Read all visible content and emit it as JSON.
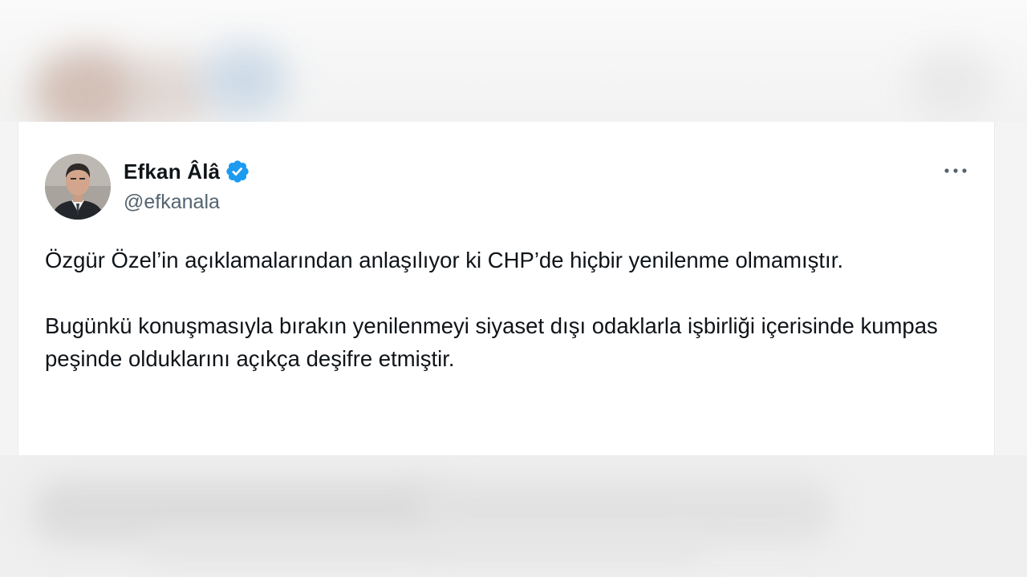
{
  "tweet": {
    "author_name": "Efkan Âlâ",
    "author_handle": "@efkanala",
    "verified_icon": "verified-badge-icon",
    "verified_color": "#1d9bf0",
    "more_icon": "more-options-icon",
    "paragraphs": [
      "Özgür Özel’in açıklamalarından anlaşılıyor ki CHP’de hiçbir yenilenme olmamıştır.",
      "Bugünkü konuşmasıyla bırakın yenilenmeyi siyaset dışı odaklarla işbirliği içerisinde kumpas peşinde olduklarını açıkça deşifre etmiştir."
    ]
  },
  "colors": {
    "text_primary": "#0f1419",
    "text_secondary": "#536471",
    "card_background": "#ffffff"
  }
}
